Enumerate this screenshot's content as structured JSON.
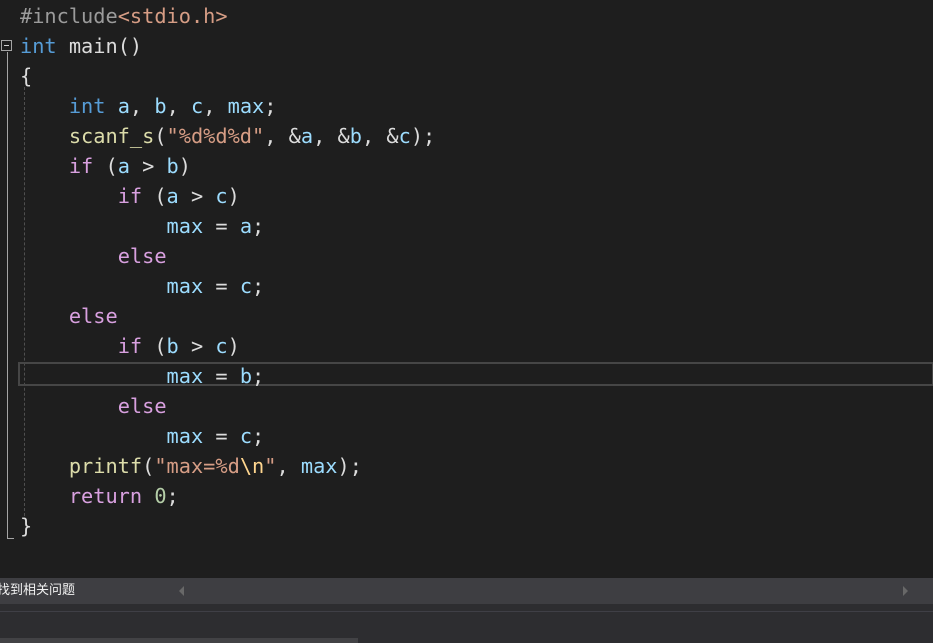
{
  "code": {
    "line1": {
      "directive": "#include",
      "header": "<stdio.h>"
    },
    "line2": {
      "type": "int",
      "rest": " main()"
    },
    "line3": "{",
    "line4": {
      "type": "int",
      "a": "a",
      "sep1": ", ",
      "b": "b",
      "sep2": ", ",
      "c": "c",
      "sep3": ", ",
      "max": "max",
      "end": ";"
    },
    "line5": {
      "fn": "scanf_s",
      "open": "(",
      "fmt": "\"%d%d%d\"",
      "args_pre": ", &",
      "a": "a",
      "args_mid1": ", &",
      "b": "b",
      "args_mid2": ", &",
      "c": "c",
      "end": ");"
    },
    "line6": {
      "kw": "if",
      "open": " (",
      "a": "a",
      "op": " > ",
      "b": "b",
      "close": ")"
    },
    "line7": {
      "kw": "if",
      "open": " (",
      "a": "a",
      "op": " > ",
      "c": "c",
      "close": ")"
    },
    "line8": {
      "max": "max",
      "eq": " = ",
      "val": "a",
      "end": ";"
    },
    "line9": {
      "kw": "else"
    },
    "line10": {
      "max": "max",
      "eq": " = ",
      "val": "c",
      "end": ";"
    },
    "line11": {
      "kw": "else"
    },
    "line12": {
      "kw": "if",
      "open": " (",
      "b": "b",
      "op": " > ",
      "c": "c",
      "close": ")"
    },
    "line13": {
      "max": "max",
      "eq": " = ",
      "val": "b",
      "end": ";"
    },
    "line14": {
      "kw": "else"
    },
    "line15": {
      "max": "max",
      "eq": " = ",
      "val": "c",
      "end": ";"
    },
    "line16": {
      "fn": "printf",
      "open": "(",
      "fmt_pre": "\"max=%d",
      "esc": "\\n",
      "fmt_post": "\"",
      "sep": ", ",
      "max": "max",
      "end": ");"
    },
    "line17": {
      "kw": "return",
      "sp": " ",
      "num": "0",
      "end": ";"
    },
    "line18": "}"
  },
  "panel": {
    "status_text": "找到相关问题"
  },
  "icons": {
    "collapse": "collapse-minus-icon",
    "scroll_left": "scroll-left-arrow-icon",
    "scroll_right": "scroll-right-arrow-icon"
  },
  "colors": {
    "background": "#1e1e1e",
    "keyword": "#569cd6",
    "control": "#d8a0df",
    "function": "#dcdcaa",
    "variable": "#9cdcfe",
    "string": "#d69d85",
    "number": "#b5cea8",
    "panel": "#3e3e42"
  }
}
